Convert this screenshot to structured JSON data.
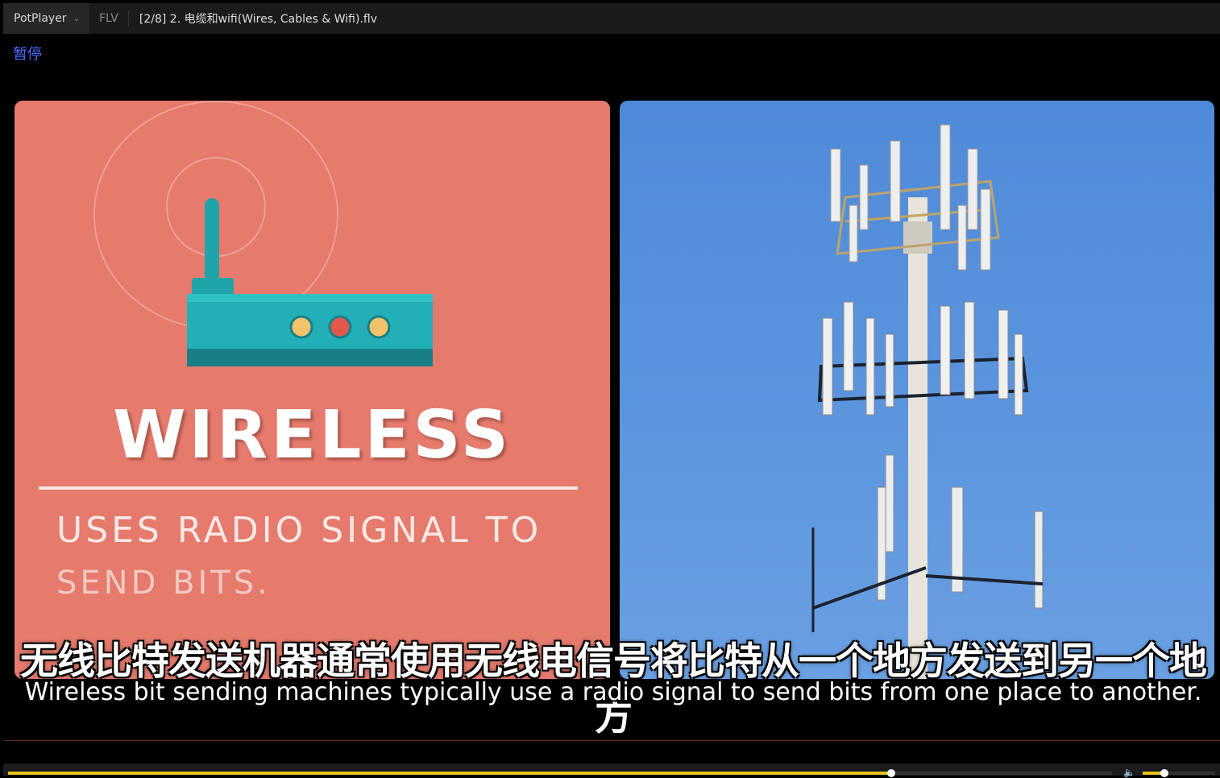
{
  "titlebar": {
    "app_name": "PotPlayer",
    "format": "FLV",
    "file_title": "[2/8] 2. 电缆和wifi(Wires, Cables & Wifi).flv"
  },
  "osd": {
    "status": "暂停"
  },
  "video": {
    "slide_title": "WIRELESS",
    "slide_line1": "USES RADIO SIGNAL TO",
    "slide_line2": "SEND BITS."
  },
  "subtitles": {
    "zh": "无线比特发送机器通常使用无线电信号将比特从一个地方发送到另一个地方",
    "en": "Wireless bit sending machines typically use a radio signal to send bits from one place to another."
  },
  "controls": {
    "seek_progress": 0.8,
    "volume_level": 0.3
  },
  "colors": {
    "accent": "#e8c31a",
    "osd": "#4a6cff",
    "slide_bg": "#e57a6d",
    "router": "#1fa4aa"
  },
  "icons": [
    "chevron-down-icon",
    "volume-icon"
  ]
}
